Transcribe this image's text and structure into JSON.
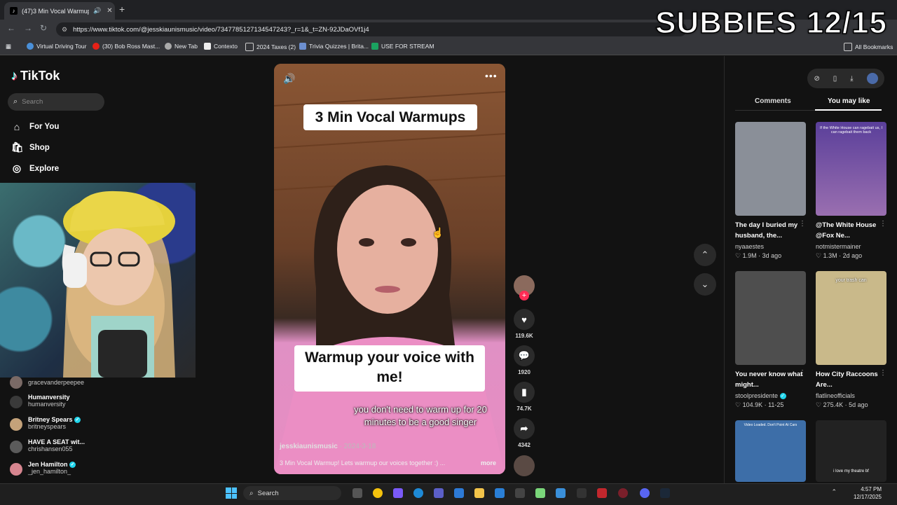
{
  "browser": {
    "tab_title": "(47)3 Min Vocal Warmup! |",
    "url": "https://www.tiktok.com/@jesskiaunismusic/video/7347785127134547243?_r=1&_t=ZN-92JDaOVf1j4",
    "bookmarks": [
      "Virtual Driving Tour",
      "(30) Bob Ross Mast...",
      "New Tab",
      "Contexto",
      "2024 Taxes (2)",
      "Trivia Quizzes | Brita...",
      "USE FOR STREAM"
    ],
    "all_bookmarks": "All Bookmarks"
  },
  "overlay": {
    "subbies": "SUBBIES 12/15"
  },
  "tiktok": {
    "logo": "TikTok",
    "search_placeholder": "Search",
    "nav": [
      "For You",
      "Shop",
      "Explore"
    ],
    "following": [
      {
        "name": "gracevanderpeepee",
        "handle": ""
      },
      {
        "name": "Humanversity",
        "handle": "humanversity"
      },
      {
        "name": "Britney Spears",
        "handle": "britneyspears",
        "verified": true
      },
      {
        "name": "HAVE A SEAT wit...",
        "handle": "chrishansen055"
      },
      {
        "name": "Jen Hamilton",
        "handle": "_jen_hamilton_",
        "verified": true
      }
    ]
  },
  "video": {
    "caption_top": "3 Min Vocal Warmups",
    "caption_bottom": "Warmup your voice with me!",
    "subtitle": "you don't need to warm up for 20 minutes to be a good singer",
    "author": "jesskiaunismusic",
    "date": "· 2024-3-18",
    "description": "3 Min Vocal Warmup! Lets warmup our voices together :) ...",
    "more": "more"
  },
  "actions": {
    "likes": "119.6K",
    "comments": "1920",
    "saves": "74.7K",
    "shares": "4342"
  },
  "panel": {
    "tab_comments": "Comments",
    "tab_you_may_like": "You may like",
    "cards": [
      {
        "title": "The day I buried my husband, the...",
        "user": "nyaaestes",
        "meta": "♡ 1.9M · 3d ago",
        "thumb_color": "#8a8f98"
      },
      {
        "title": "@The White House @Fox Ne...",
        "user": "notmistermainer",
        "meta": "♡ 1.3M · 2d ago",
        "thumb_color": "#7a5fa5",
        "thumb_text": "If the White House can ragebait us, I can ragebait them back"
      },
      {
        "title": "You never know what might...",
        "user": "stoolpresidente",
        "meta": "♡ 104.9K · 11-25",
        "thumb_color": "#4e4e4e",
        "verified": true
      },
      {
        "title": "How City Raccoons Are...",
        "user": "flatlineofficials",
        "meta": "♡ 275.4K · 5d ago",
        "thumb_color": "#c9b98a",
        "thumb_text": "your trash can"
      },
      {
        "title": "",
        "user": "",
        "meta": "",
        "thumb_color": "#3d6ea8",
        "thumb_text": "Video Loaded. Don't Point At Cars"
      },
      {
        "title": "",
        "user": "",
        "meta": "",
        "thumb_color": "#222222",
        "thumb_text": "i love my theatre bf"
      }
    ]
  },
  "taskbar": {
    "search": "Search",
    "time": "4:57 PM",
    "date": "12/17/2025"
  }
}
